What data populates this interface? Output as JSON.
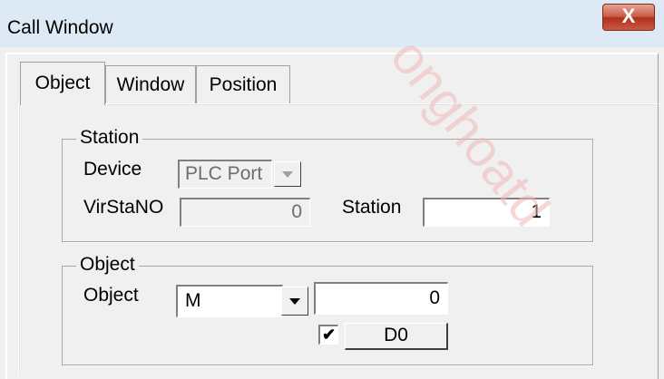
{
  "window": {
    "title": "Call Window",
    "close_glyph": "X"
  },
  "tabs": [
    {
      "label": "Object",
      "active": true
    },
    {
      "label": "Window",
      "active": false
    },
    {
      "label": "Position",
      "active": false
    }
  ],
  "station_group": {
    "legend": "Station",
    "device_label": "Device",
    "device_value": "PLC Port",
    "virstano_label": "VirStaNO",
    "virstano_value": "0",
    "station_label": "Station",
    "station_value": "1"
  },
  "object_group": {
    "legend": "Object",
    "object_label": "Object",
    "object_type": "M",
    "object_address": "0",
    "checkbox_checked": true,
    "checkbox_glyph": "✔",
    "d_button_label": "D0"
  },
  "watermark": {
    "text": "onghoatd"
  },
  "colors": {
    "background": "#f0f0f0",
    "titlebar": "#dde9f5",
    "close_button": "#c75b45"
  }
}
